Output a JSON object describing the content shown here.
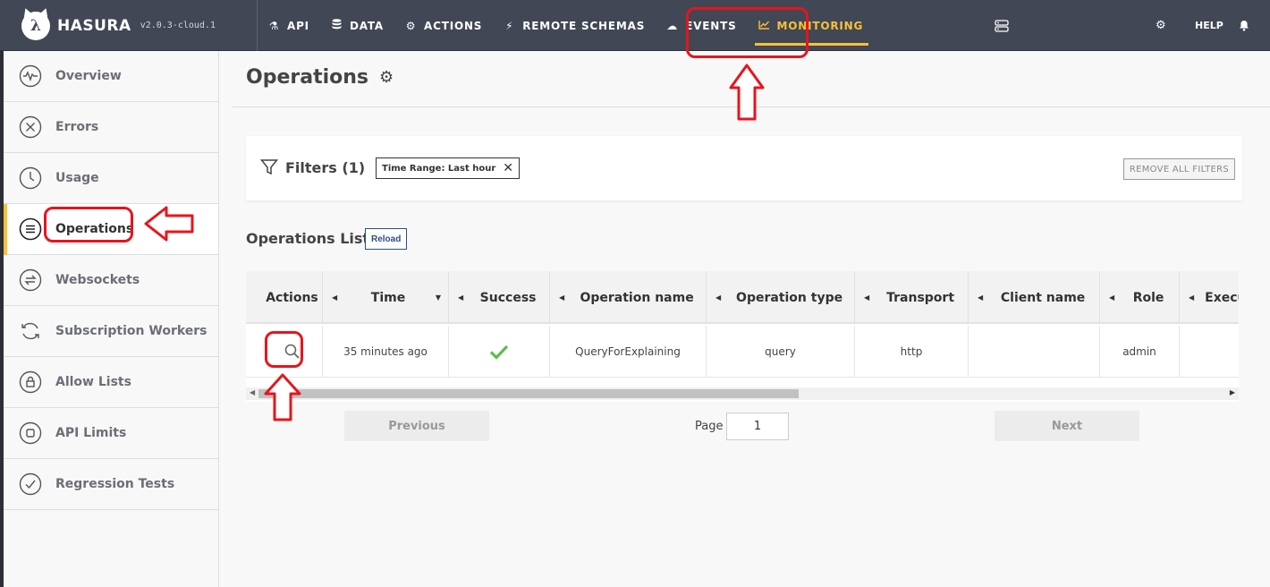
{
  "brand": {
    "name": "HASURA",
    "version": "v2.0.3-cloud.1"
  },
  "nav": {
    "items": [
      {
        "label": "API",
        "icon": "flask-icon"
      },
      {
        "label": "DATA",
        "icon": "database-icon"
      },
      {
        "label": "ACTIONS",
        "icon": "gears-icon"
      },
      {
        "label": "REMOTE SCHEMAS",
        "icon": "plug-icon"
      },
      {
        "label": "EVENTS",
        "icon": "cloud-icon"
      },
      {
        "label": "MONITORING",
        "icon": "chart-line-icon",
        "active": true
      }
    ],
    "help": "HELP"
  },
  "sidebar": {
    "items": [
      {
        "label": "Overview",
        "icon": "pulse-icon"
      },
      {
        "label": "Errors",
        "icon": "x-circle-icon"
      },
      {
        "label": "Usage",
        "icon": "clock-icon"
      },
      {
        "label": "Operations",
        "icon": "list-circle-icon",
        "active": true
      },
      {
        "label": "Websockets",
        "icon": "arrows-circle-icon"
      },
      {
        "label": "Subscription Workers",
        "icon": "refresh-icon"
      },
      {
        "label": "Allow Lists",
        "icon": "lock-circle-icon"
      },
      {
        "label": "API Limits",
        "icon": "square-circle-icon"
      },
      {
        "label": "Regression Tests",
        "icon": "check-circle-icon"
      }
    ]
  },
  "page": {
    "title": "Operations"
  },
  "filters": {
    "title": "Filters (1)",
    "chip": "Time Range: Last hour",
    "remove_all": "REMOVE ALL FILTERS"
  },
  "operations": {
    "title": "Operations List",
    "reload": "Reload",
    "columns": [
      "Actions",
      "Time",
      "Success",
      "Operation name",
      "Operation type",
      "Transport",
      "Client name",
      "Role",
      "Execu"
    ],
    "rows": [
      {
        "time": "35 minutes ago",
        "operation_name": "QueryForExplaining",
        "operation_type": "query",
        "transport": "http",
        "client_name": "",
        "role": "admin"
      }
    ]
  },
  "pagination": {
    "previous": "Previous",
    "next": "Next",
    "page_label": "Page",
    "page": "1"
  },
  "colors": {
    "nav_bg": "#414755",
    "accent": "#f8c138",
    "annotation": "#e8141b",
    "success": "#5bbf4a"
  }
}
